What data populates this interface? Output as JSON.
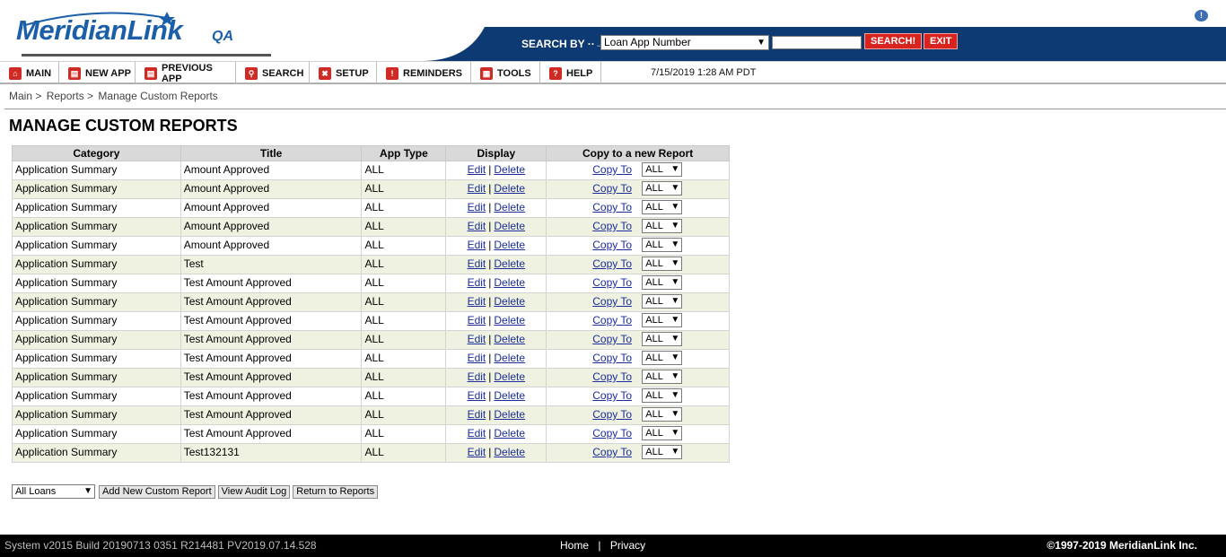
{
  "header": {
    "logo_text": "MeridianLink",
    "logo_suffix": "QA",
    "search_by_label": "SEARCH BY ··→",
    "search_select_value": "Loan App Number",
    "search_input_value": "",
    "search_button": "SEARCH!",
    "exit_button": "EXIT"
  },
  "nav": {
    "items": [
      {
        "label": "MAIN",
        "icon": "home-icon"
      },
      {
        "label": "NEW APP",
        "icon": "new-app-icon"
      },
      {
        "label": "PREVIOUS APP",
        "icon": "previous-app-icon"
      },
      {
        "label": "SEARCH",
        "icon": "search-icon"
      },
      {
        "label": "SETUP",
        "icon": "setup-icon"
      },
      {
        "label": "REMINDERS",
        "icon": "reminders-icon"
      },
      {
        "label": "TOOLS",
        "icon": "tools-icon"
      },
      {
        "label": "HELP",
        "icon": "help-icon"
      }
    ],
    "datetime": "7/15/2019 1:28 AM PDT"
  },
  "breadcrumb": {
    "main": "Main >",
    "reports": "Reports >",
    "current": "Manage Custom Reports"
  },
  "page_title": "MANAGE CUSTOM REPORTS",
  "table": {
    "headers": {
      "category": "Category",
      "title": "Title",
      "app_type": "App Type",
      "display": "Display",
      "copy": "Copy to a new Report"
    },
    "edit_label": "Edit",
    "delete_label": "Delete",
    "separator": "|",
    "copy_label": "Copy To",
    "rows": [
      {
        "category": "Application Summary",
        "title": "Amount Approved",
        "app_type": "ALL",
        "copy_type": "ALL"
      },
      {
        "category": "Application Summary",
        "title": "Amount Approved",
        "app_type": "ALL",
        "copy_type": "ALL"
      },
      {
        "category": "Application Summary",
        "title": "Amount Approved",
        "app_type": "ALL",
        "copy_type": "ALL"
      },
      {
        "category": "Application Summary",
        "title": "Amount Approved",
        "app_type": "ALL",
        "copy_type": "ALL"
      },
      {
        "category": "Application Summary",
        "title": "Amount Approved",
        "app_type": "ALL",
        "copy_type": "ALL"
      },
      {
        "category": "Application Summary",
        "title": "Test",
        "app_type": "ALL",
        "copy_type": "ALL"
      },
      {
        "category": "Application Summary",
        "title": "Test Amount Approved",
        "app_type": "ALL",
        "copy_type": "ALL"
      },
      {
        "category": "Application Summary",
        "title": "Test Amount Approved",
        "app_type": "ALL",
        "copy_type": "ALL"
      },
      {
        "category": "Application Summary",
        "title": "Test Amount Approved",
        "app_type": "ALL",
        "copy_type": "ALL"
      },
      {
        "category": "Application Summary",
        "title": "Test Amount Approved",
        "app_type": "ALL",
        "copy_type": "ALL"
      },
      {
        "category": "Application Summary",
        "title": "Test Amount Approved",
        "app_type": "ALL",
        "copy_type": "ALL"
      },
      {
        "category": "Application Summary",
        "title": "Test Amount Approved",
        "app_type": "ALL",
        "copy_type": "ALL"
      },
      {
        "category": "Application Summary",
        "title": "Test Amount Approved",
        "app_type": "ALL",
        "copy_type": "ALL"
      },
      {
        "category": "Application Summary",
        "title": "Test Amount Approved",
        "app_type": "ALL",
        "copy_type": "ALL"
      },
      {
        "category": "Application Summary",
        "title": "Test Amount Approved",
        "app_type": "ALL",
        "copy_type": "ALL"
      },
      {
        "category": "Application Summary",
        "title": "Test132131",
        "app_type": "ALL",
        "copy_type": "ALL"
      }
    ]
  },
  "bottom": {
    "loan_select_value": "All Loans",
    "add_button": "Add New Custom Report",
    "audit_button": "View Audit Log",
    "return_button": "Return to Reports"
  },
  "footer": {
    "system_info": "System v2015 Build 20190713 0351 R214481 PV2019.07.14.528",
    "home_link": "Home",
    "separator": "|",
    "privacy_link": "Privacy",
    "copyright": "©1997-2019 MeridianLink Inc."
  },
  "colors": {
    "brand_blue": "#0d3a73",
    "logo_blue": "#1a5fa8",
    "accent_red": "#d9231f",
    "row_alt": "#eff2e0",
    "link": "#1a2d9a"
  }
}
